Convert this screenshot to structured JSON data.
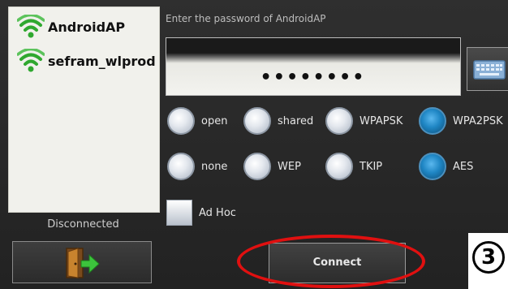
{
  "networks": [
    {
      "name": "AndroidAP",
      "icon": "wifi-signal-icon"
    },
    {
      "name": "sefram_wlprod",
      "icon": "wifi-signal-icon"
    }
  ],
  "status": "Disconnected",
  "password": {
    "prompt": "Enter the password of AndroidAP",
    "masked_value": "••••••••"
  },
  "security_options": [
    {
      "label": "open",
      "selected": false
    },
    {
      "label": "shared",
      "selected": false
    },
    {
      "label": "WPAPSK",
      "selected": false
    },
    {
      "label": "WPA2PSK",
      "selected": true
    }
  ],
  "encryption_options": [
    {
      "label": "none",
      "selected": false
    },
    {
      "label": "WEP",
      "selected": false
    },
    {
      "label": "TKIP",
      "selected": false
    },
    {
      "label": "AES",
      "selected": true
    }
  ],
  "adhoc": {
    "label": "Ad Hoc",
    "checked": false
  },
  "buttons": {
    "connect": "Connect",
    "exit_icon": "exit-door-icon",
    "keyboard_icon": "keyboard-icon"
  },
  "annotation": {
    "step_number": "3",
    "highlight_color": "#e01010"
  },
  "colors": {
    "selected_radio": "#1f86c4",
    "wifi_green": "#2fa82f"
  }
}
